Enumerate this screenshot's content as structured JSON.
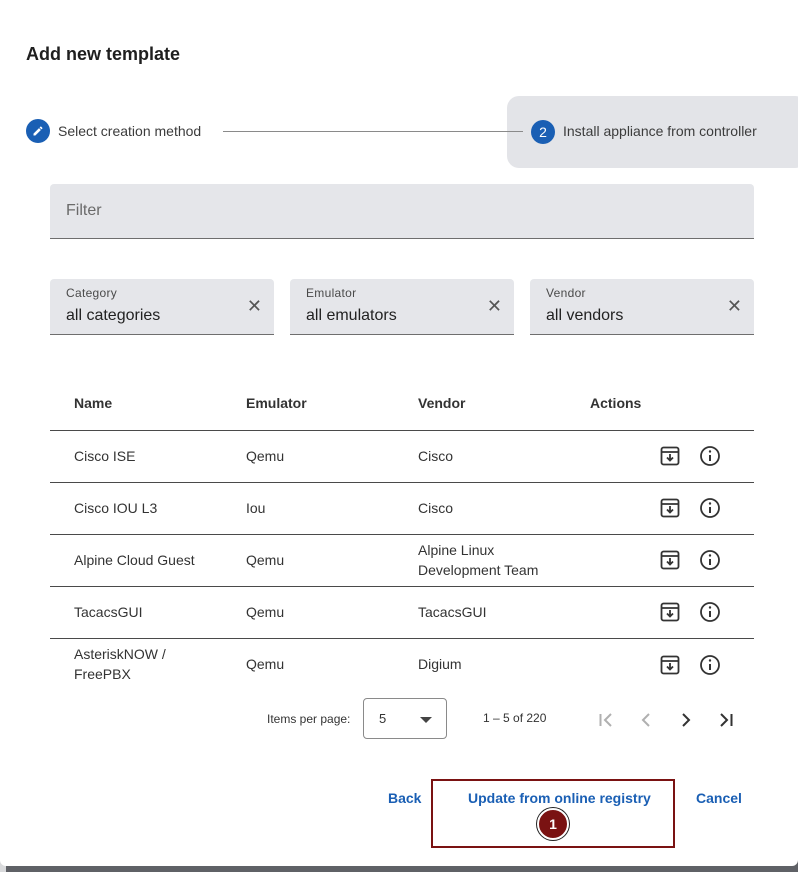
{
  "dialog": {
    "title": "Add new template"
  },
  "stepper": {
    "steps": [
      {
        "number": "1",
        "label": "Select creation method",
        "icon": "pencil-icon",
        "state": "completed"
      },
      {
        "number": "2",
        "label": "Install appliance from controller",
        "state": "active"
      }
    ]
  },
  "filter": {
    "placeholder": "Filter",
    "value": ""
  },
  "selects": [
    {
      "label": "Category",
      "value": "all categories"
    },
    {
      "label": "Emulator",
      "value": "all emulators"
    },
    {
      "label": "Vendor",
      "value": "all vendors"
    }
  ],
  "table": {
    "headers": [
      "Name",
      "Emulator",
      "Vendor",
      "Actions"
    ],
    "rows": [
      {
        "name": "Cisco ISE",
        "emulator": "Qemu",
        "vendor": "Cisco"
      },
      {
        "name": "Cisco IOU L3",
        "emulator": "Iou",
        "vendor": "Cisco"
      },
      {
        "name": "Alpine Cloud Guest",
        "emulator": "Qemu",
        "vendor": "Alpine Linux Development Team"
      },
      {
        "name": "TacacsGUI",
        "emulator": "Qemu",
        "vendor": "TacacsGUI"
      },
      {
        "name": "AsteriskNOW / FreePBX",
        "emulator": "Qemu",
        "vendor": "Digium"
      }
    ],
    "actions": [
      "install-icon",
      "info-icon"
    ]
  },
  "paginator": {
    "items_per_page_label": "Items per page:",
    "page_size": "5",
    "range": "1 – 5 of 220"
  },
  "footer": {
    "back_label": "Back",
    "update_label": "Update from online registry",
    "cancel_label": "Cancel"
  },
  "annotation": {
    "badge": "1"
  },
  "colors": {
    "accent": "#1a5fb4",
    "annotation": "#7a1212",
    "field_bg": "#e5e6ea"
  }
}
